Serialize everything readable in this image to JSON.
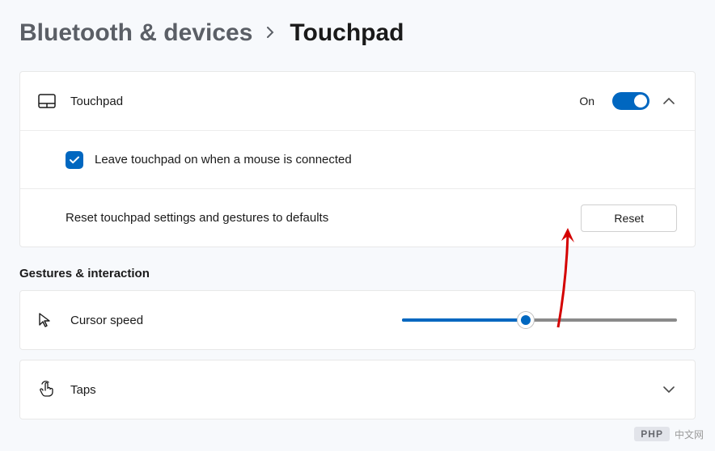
{
  "breadcrumb": {
    "parent": "Bluetooth & devices",
    "current": "Touchpad"
  },
  "touchpad": {
    "title": "Touchpad",
    "toggle_state": "On",
    "leave_on_label": "Leave touchpad on when a mouse is connected",
    "reset_label": "Reset touchpad settings and gestures to defaults",
    "reset_button": "Reset"
  },
  "gestures_section": "Gestures & interaction",
  "cursor_speed": {
    "label": "Cursor speed",
    "value": 45
  },
  "taps": {
    "label": "Taps"
  },
  "watermark": {
    "badge": "PHP",
    "text": "中文网"
  }
}
